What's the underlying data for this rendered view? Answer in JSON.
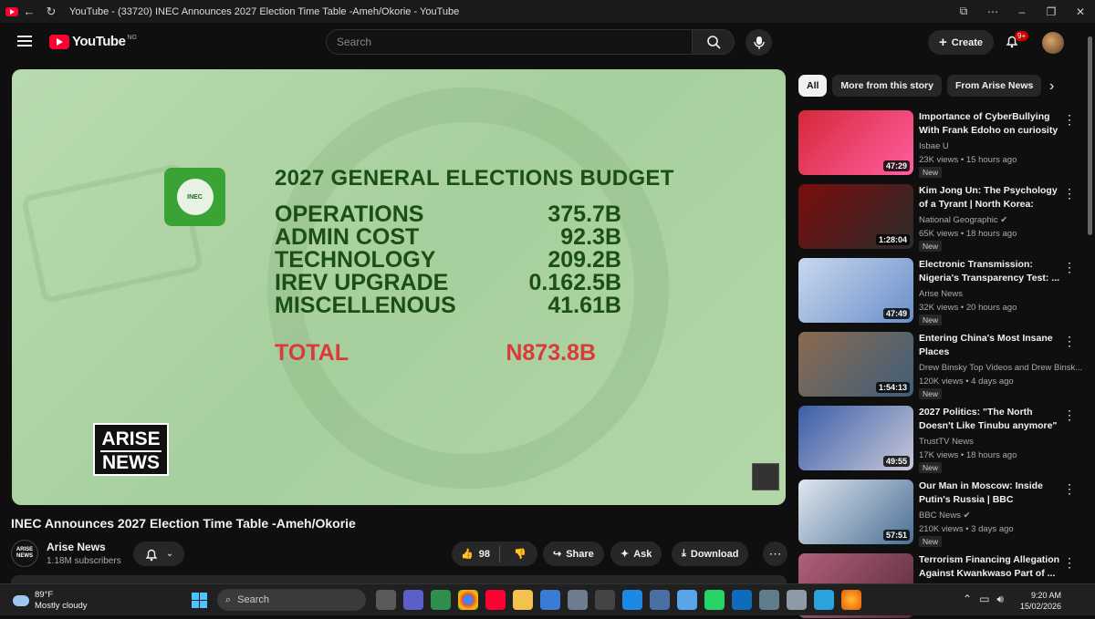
{
  "browser": {
    "tab_title": "YouTube - (33720) INEC Announces 2027 Election Time Table -Ameh/Okorie - YouTube"
  },
  "masthead": {
    "logo_text": "YouTube",
    "region": "NG",
    "search_placeholder": "Search",
    "create_label": "Create",
    "notif_count": "9+"
  },
  "video": {
    "budget_title": "2027 GENERAL ELECTIONS BUDGET",
    "rows": [
      {
        "label": "OPERATIONS",
        "value": "375.7B"
      },
      {
        "label": "ADMIN COST",
        "value": "92.3B"
      },
      {
        "label": "TECHNOLOGY",
        "value": "209.2B"
      },
      {
        "label": "IREV UPGRADE",
        "value": "0.162.5B"
      },
      {
        "label": "MISCELLENOUS",
        "value": "41.61B"
      }
    ],
    "total_label": "TOTAL",
    "total_value": "N873.8B",
    "logo_top": "ARISE",
    "logo_bottom": "NEWS",
    "inec_text": "INEC"
  },
  "meta": {
    "title": "INEC Announces 2027 Election Time Table -Ameh/Okorie",
    "channel": "Arise News",
    "subscribers": "1.18M subscribers",
    "channel_avatar": "ARISE NEWS",
    "likes": "98",
    "share": "Share",
    "ask": "Ask",
    "download": "Download"
  },
  "chips": [
    "All",
    "More from this story",
    "From Arise News"
  ],
  "recs": [
    {
      "title": "Importance of CyberBullying With Frank Edoho on curiosity ...",
      "channel": "Isbae U",
      "meta": "23K views • 15 hours ago",
      "duration": "47:29",
      "badge": "New",
      "c1": "#d62839",
      "c2": "#ff5fa2"
    },
    {
      "title": "Kim Jong Un: The Psychology of a Tyrant | North Korea: Insid...",
      "channel": "National Geographic ✔",
      "meta": "65K views • 18 hours ago",
      "duration": "1:28:04",
      "badge": "New",
      "c1": "#7a0d0d",
      "c2": "#2b2b2b"
    },
    {
      "title": "Electronic Transmission: Nigeria's Transparency Test: ...",
      "channel": "Arise News",
      "meta": "32K views • 20 hours ago",
      "duration": "47:49",
      "badge": "New",
      "c1": "#c9d8ee",
      "c2": "#6a8fc9"
    },
    {
      "title": "Entering China's Most Insane Places",
      "channel": "Drew Binsky Top Videos and Drew Binsk...",
      "meta": "120K views • 4 days ago",
      "duration": "1:54:13",
      "badge": "New",
      "c1": "#8c6a4f",
      "c2": "#3d5f7a"
    },
    {
      "title": "2027 Politics: \"The North Doesn't Like Tinubu anymore\" ...",
      "channel": "TrustTV News",
      "meta": "17K views • 18 hours ago",
      "duration": "49:55",
      "badge": "New",
      "c1": "#3b5ea8",
      "c2": "#c8c8d8"
    },
    {
      "title": "Our Man in Moscow: Inside Putin's Russia | BBC Panorama",
      "channel": "BBC News ✔",
      "meta": "210K views • 3 days ago",
      "duration": "57:51",
      "badge": "New",
      "c1": "#dfe7ef",
      "c2": "#4b6f95"
    },
    {
      "title": "Terrorism Financing Allegation Against Kwankwaso Part of ...",
      "channel": "",
      "meta": "",
      "duration": "",
      "badge": "",
      "c1": "#b0607a",
      "c2": "#5a2a3a"
    }
  ],
  "taskbar": {
    "temp": "89°F",
    "weather": "Mostly cloudy",
    "search": "Search",
    "time": "9:20 AM",
    "date": "15/02/2026"
  }
}
